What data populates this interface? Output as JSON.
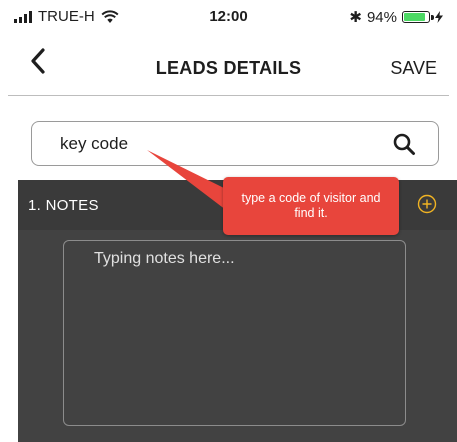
{
  "status_bar": {
    "carrier": "TRUE-H",
    "time": "12:00",
    "bluetooth_symbol": "✱",
    "battery_percent": "94%",
    "battery_level": 0.94,
    "battery_color": "#4cd964"
  },
  "nav": {
    "back_icon": "chevron-left-icon",
    "title": "LEADS DETAILS",
    "save_label": "SAVE"
  },
  "search": {
    "value": "key code",
    "icon": "search-icon"
  },
  "notes": {
    "section_title": "1. NOTES",
    "add_icon": "add-circle-icon",
    "accent_color": "#f0b323",
    "placeholder": "Typing notes here..."
  },
  "tooltip": {
    "text": "type a code of visitor and find it.",
    "color": "#e8453c"
  }
}
